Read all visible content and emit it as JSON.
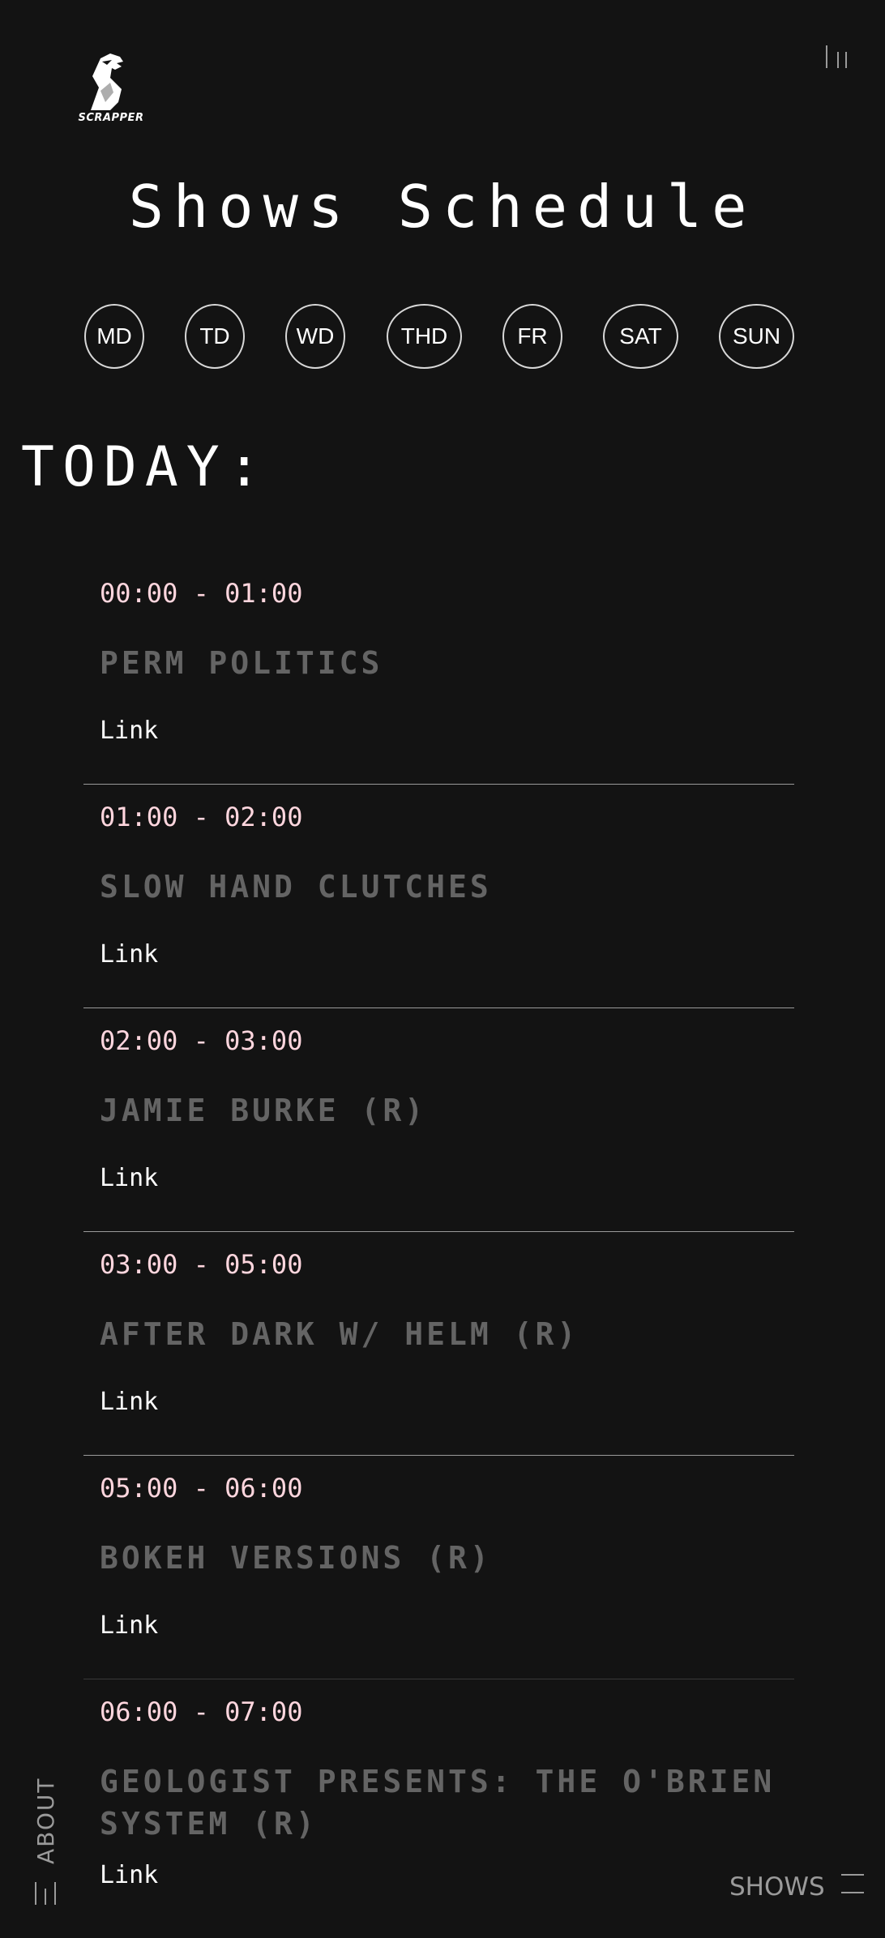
{
  "brand": {
    "name": "SCRAPPER"
  },
  "header": {
    "title": "Shows Schedule"
  },
  "days": [
    "MD",
    "TD",
    "WD",
    "THD",
    "FR",
    "SAT",
    "SUN"
  ],
  "schedule": {
    "heading": "TODAY:",
    "shows": [
      {
        "time": "00:00 - 01:00",
        "title": "PERM POLITICS",
        "link_label": "Link"
      },
      {
        "time": "01:00 - 02:00",
        "title": "SLOW HAND CLUTCHES",
        "link_label": "Link"
      },
      {
        "time": "02:00 - 03:00",
        "title": "JAMIE BURKE (R)",
        "link_label": "Link"
      },
      {
        "time": "03:00 - 05:00",
        "title": "AFTER DARK W/ HELM (R)",
        "link_label": "Link"
      },
      {
        "time": "05:00 - 06:00",
        "title": "BOKEH VERSIONS (R)",
        "link_label": "Link"
      },
      {
        "time": "06:00 - 07:00",
        "title": "GEOLOGIST PRESENTS: THE O'BRIEN SYSTEM (R)",
        "link_label": "Link"
      }
    ]
  },
  "nav": {
    "about_label": "ABOUT",
    "shows_label": "SHOWS"
  },
  "icons": {
    "logo": "horse-head-logo-icon",
    "menu": "menu-bars-icon",
    "about": "vertical-bars-icon",
    "shows": "horizontal-bars-icon"
  },
  "colors": {
    "background": "#131313",
    "time_text": "#ffd6de",
    "title_text": "#646464",
    "text": "#ffffff",
    "muted": "#9a9a9a"
  }
}
